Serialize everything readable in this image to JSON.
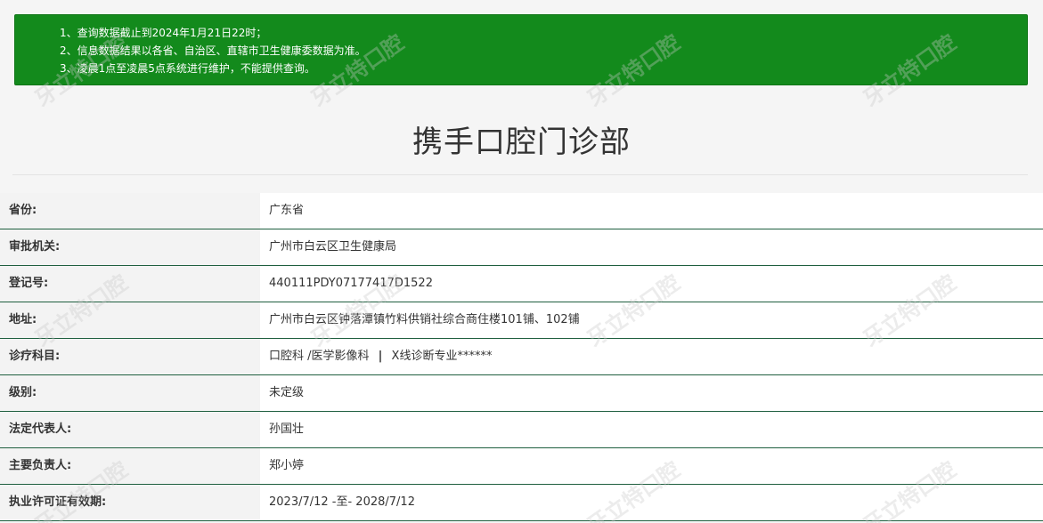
{
  "notice": {
    "lines": [
      "1、查询数据截止到2024年1月21日22时；",
      "2、信息数据结果以各省、自治区、直辖市卫生健康委数据为准。",
      "3、凌晨1点至凌晨5点系统进行维护，不能提供查询。"
    ],
    "background_color": "#138a1c"
  },
  "page_title": "携手口腔门诊部",
  "watermark": "牙立特口腔",
  "fields": [
    {
      "label": "省份:",
      "value": "广东省"
    },
    {
      "label": "审批机关:",
      "value": "广州市白云区卫生健康局"
    },
    {
      "label": "登记号:",
      "value": "440111PDY07177417D1522"
    },
    {
      "label": "地址:",
      "value": "广州市白云区钟落潭镇竹料供销社综合商住楼101铺、102铺"
    },
    {
      "label": "诊疗科目:",
      "value_parts": [
        "口腔科 /医学影像科",
        "|",
        "X线诊断专业******"
      ]
    },
    {
      "label": "级别:",
      "value": "未定级"
    },
    {
      "label": "法定代表人:",
      "value": "孙国壮"
    },
    {
      "label": "主要负责人:",
      "value": "郑小婷"
    },
    {
      "label": "执业许可证有效期:",
      "value": "2023/7/12 -至- 2028/7/12"
    }
  ]
}
